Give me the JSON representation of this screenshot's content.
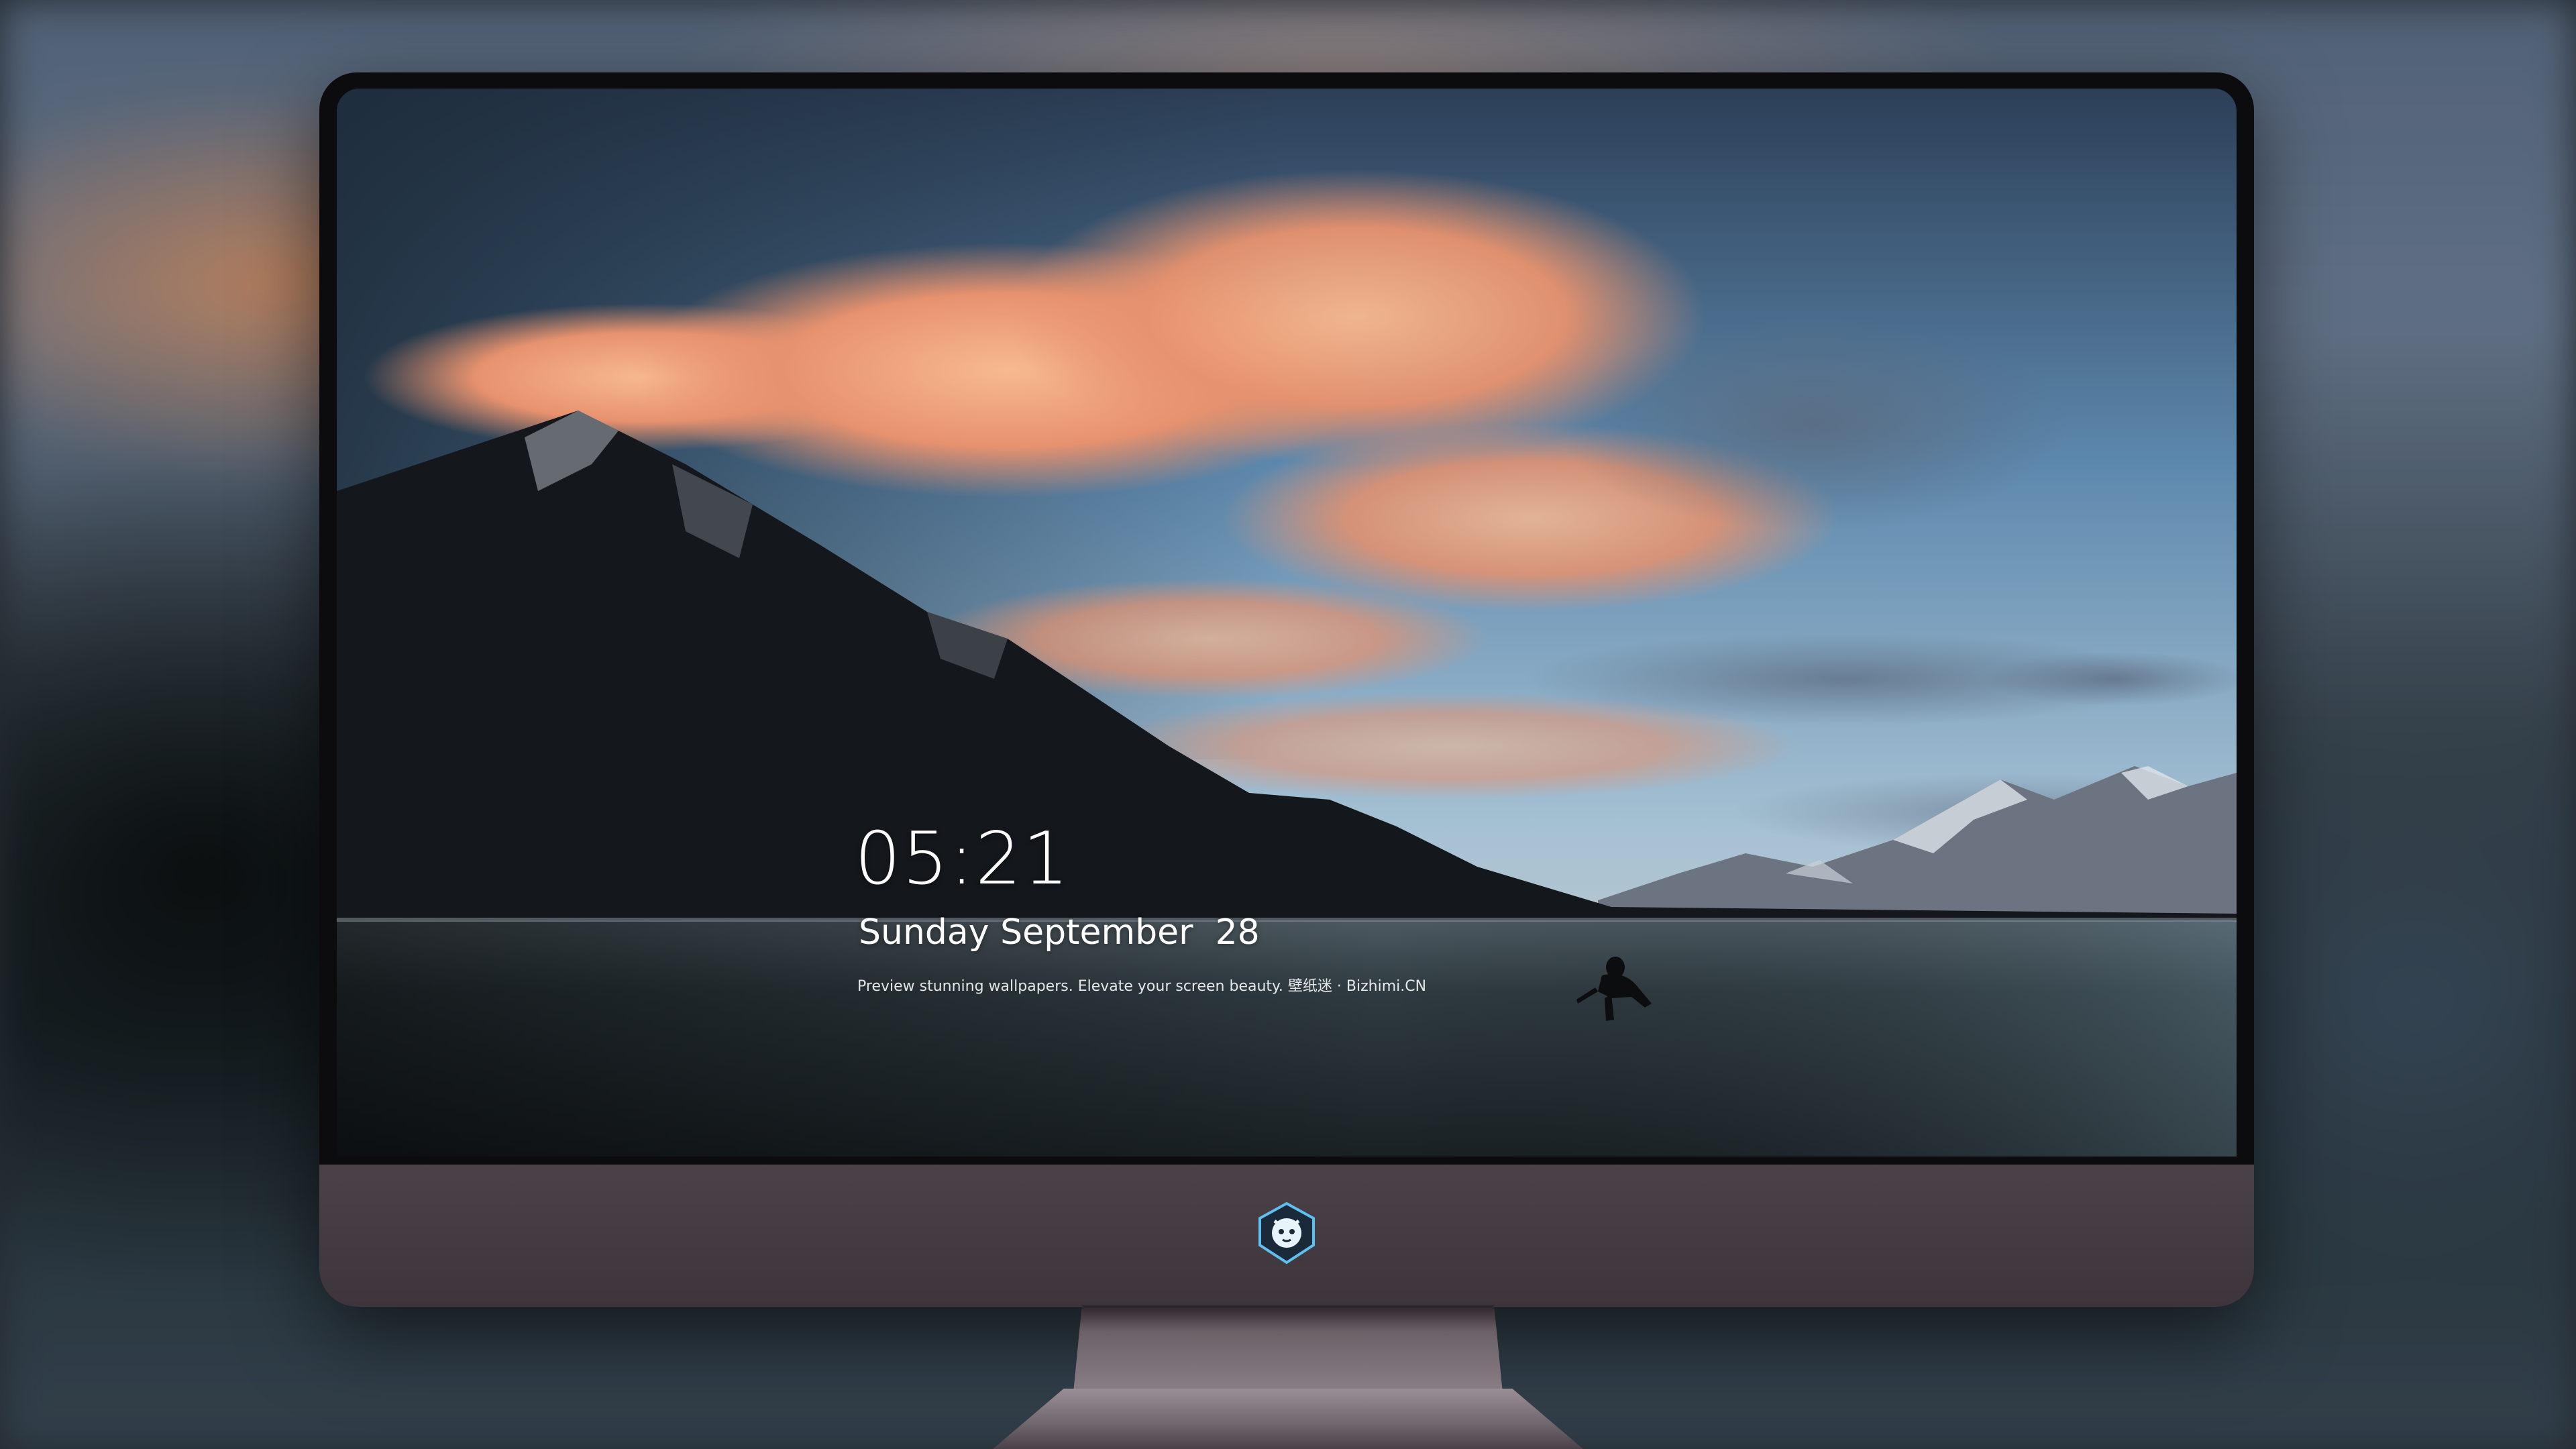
{
  "lockscreen": {
    "time": "05:21",
    "date": "Sunday September  28",
    "tagline": "Preview stunning wallpapers. Elevate your screen beauty. 壁纸迷 · Bizhimi.CN"
  },
  "dock": {
    "apps": [
      {
        "icon": "messages-icon",
        "color": "#34c759"
      },
      {
        "icon": "weather-icon",
        "color": "#2f8cf0"
      },
      {
        "icon": "clock-icon",
        "color": "#ffffff"
      },
      {
        "icon": "preview-icon",
        "color": "#d9b24c"
      },
      {
        "icon": "clips-icon",
        "color": "#2aa8d8"
      },
      {
        "icon": "notes-icon",
        "color": "#ffd84a"
      },
      {
        "icon": "photo-booth-icon",
        "color": "#e9e9e9"
      },
      {
        "icon": "music-icon",
        "color": "#e64ad6"
      },
      {
        "icon": "app-store-icon",
        "color": "#1e8cf5"
      },
      {
        "icon": "camera-icon",
        "color": "#9a9a9a"
      }
    ]
  },
  "colors": {
    "sky_top": "#3f5b7a",
    "cloud_orange": "#f2a07a",
    "bezel_chin": "#473e45"
  }
}
